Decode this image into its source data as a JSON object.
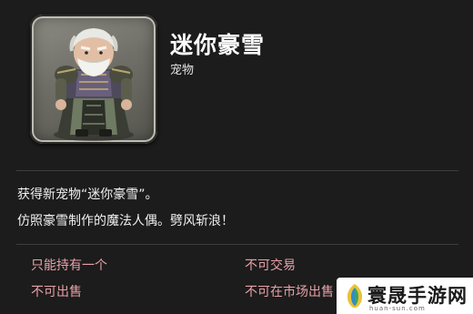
{
  "item": {
    "name": "迷你豪雪",
    "category": "宠物",
    "icon": "gosetsu-minion-portrait"
  },
  "description": {
    "line1": "获得新宠物“迷你豪雪”。",
    "line2": "仿照豪雪制作的魔法人偶。劈风斩浪！"
  },
  "attributes": {
    "unique": "只能持有一个",
    "untradable": "不可交易",
    "unsellable": "不可出售",
    "no_market": "不可在市场出售"
  },
  "watermark": {
    "text": "寰晟手游网",
    "url": "huan-sun.com",
    "icon": "leaf-logo-icon"
  },
  "colors": {
    "background": "#1c1c1c",
    "attribute_text": "#e8a0a8",
    "title_text": "#ffffff"
  }
}
